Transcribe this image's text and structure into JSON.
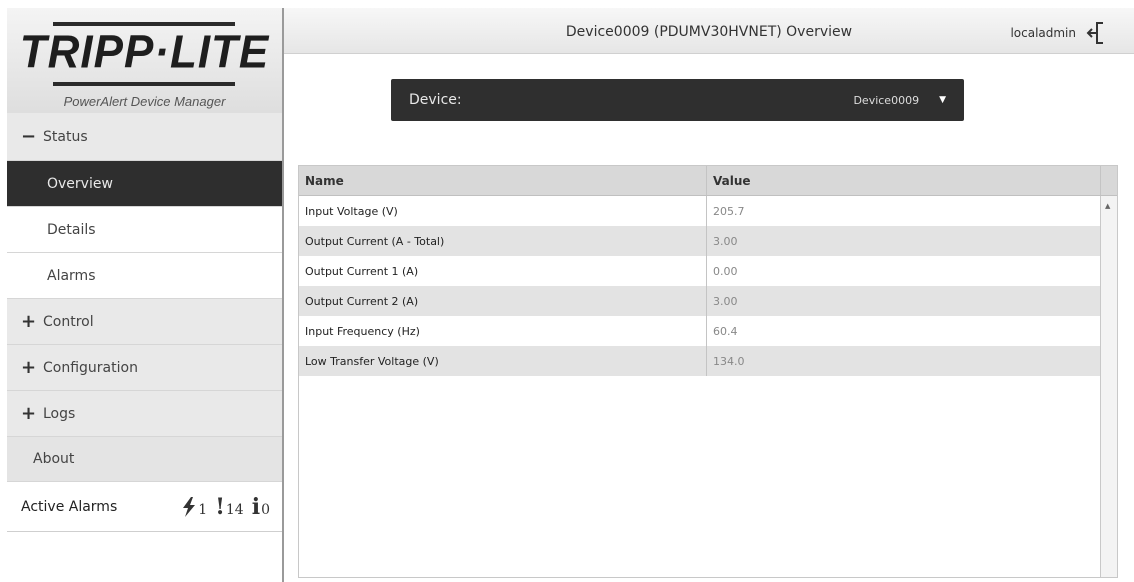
{
  "brand": {
    "logo_text": "TRIPP·LITE",
    "product": "PowerAlert Device Manager"
  },
  "sidebar": {
    "status": {
      "symbol": "−",
      "label": "Status"
    },
    "status_items": [
      {
        "label": "Overview",
        "active": true
      },
      {
        "label": "Details",
        "active": false
      },
      {
        "label": "Alarms",
        "active": false
      }
    ],
    "groups": [
      {
        "symbol": "+",
        "label": "Control"
      },
      {
        "symbol": "+",
        "label": "Configuration"
      },
      {
        "symbol": "+",
        "label": "Logs"
      }
    ],
    "about": "About",
    "active_alarms": {
      "label": "Active Alarms",
      "critical_icon": "lightning-icon",
      "critical_count": "1",
      "warning_icon": "exclamation-icon",
      "warning_count": "14",
      "info_icon": "info-icon",
      "info_count": "0"
    }
  },
  "header": {
    "title": "Device0009 (PDUMV30HVNET) Overview",
    "user": "localadmin",
    "logout_icon": "logout-icon"
  },
  "device_selector": {
    "label": "Device:",
    "value": "Device0009",
    "caret_icon": "caret-down-icon"
  },
  "table": {
    "columns": [
      "Name",
      "Value"
    ],
    "rows": [
      {
        "name": "Input Voltage (V)",
        "value": "205.7"
      },
      {
        "name": "Output Current (A - Total)",
        "value": "3.00"
      },
      {
        "name": "Output Current 1 (A)",
        "value": "0.00"
      },
      {
        "name": "Output Current 2 (A)",
        "value": "3.00"
      },
      {
        "name": "Input Frequency (Hz)",
        "value": "60.4"
      },
      {
        "name": "Low Transfer Voltage (V)",
        "value": "134.0"
      }
    ]
  },
  "colors": {
    "active_nav": "#2e2e2e",
    "device_bar": "#2f2f2f",
    "header_bg": "#eeeeee"
  }
}
